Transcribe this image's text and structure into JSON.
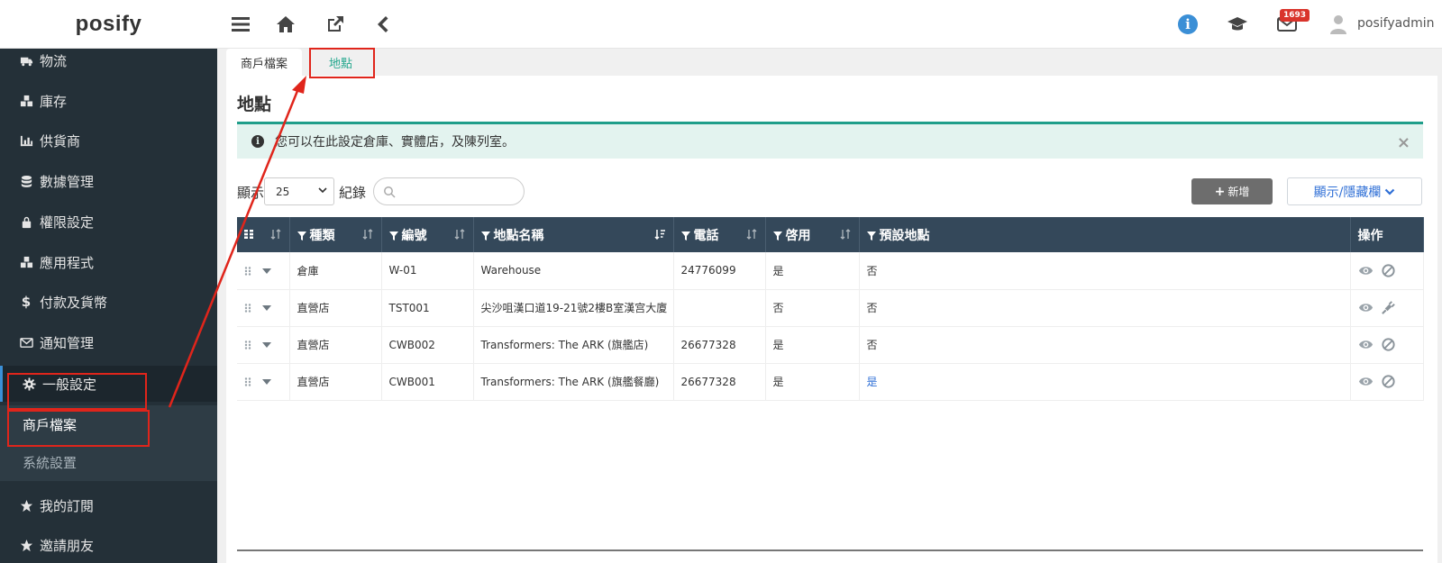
{
  "app": {
    "logo": "posify"
  },
  "topbar": {
    "mail_badge": "1693",
    "user": "posifyadmin"
  },
  "sidebar": {
    "items": [
      {
        "label": "物流",
        "icon": "truck-icon"
      },
      {
        "label": "庫存",
        "icon": "cubes-icon"
      },
      {
        "label": "供貨商",
        "icon": "chart-icon"
      },
      {
        "label": "數據管理",
        "icon": "database-icon"
      },
      {
        "label": "權限設定",
        "icon": "lock-icon"
      },
      {
        "label": "應用程式",
        "icon": "cubes-icon"
      },
      {
        "label": "付款及貨幣",
        "icon": "dollar-icon"
      },
      {
        "label": "通知管理",
        "icon": "envelope-icon"
      },
      {
        "label": "一般設定",
        "icon": "gear-icon"
      }
    ],
    "sub_items": [
      {
        "label": "商戶檔案"
      },
      {
        "label": "系統設置"
      }
    ],
    "bottom_items": [
      {
        "label": "我的訂閱",
        "icon": "star-icon"
      },
      {
        "label": "邀請朋友",
        "icon": "star-icon"
      }
    ]
  },
  "tabs": [
    {
      "label": "商戶檔案"
    },
    {
      "label": "地點"
    }
  ],
  "page": {
    "title": "地點"
  },
  "alert": {
    "message": "您可以在此設定倉庫、實體店，及陳列室。",
    "close": "×"
  },
  "list_controls": {
    "show_label": "顯示",
    "page_size": "25",
    "records_label": "紀錄",
    "search_placeholder": ""
  },
  "buttons": {
    "add": "新增",
    "add_icon": "+",
    "columns": "顯示/隱藏欄"
  },
  "table": {
    "columns": [
      "種類",
      "編號",
      "地點名稱",
      "電話",
      "啓用",
      "預設地點",
      "操作"
    ],
    "rows": [
      {
        "type": "倉庫",
        "code": "W-01",
        "name": "Warehouse",
        "phone": "24776099",
        "enabled": "是",
        "default": "否",
        "action": "disable-icon"
      },
      {
        "type": "直營店",
        "code": "TST001",
        "name": "尖沙咀漢口道19-21號2樓B室漢宫大廈",
        "phone": "",
        "enabled": "否",
        "default": "否",
        "action": "plug-icon"
      },
      {
        "type": "直營店",
        "code": "CWB002",
        "name": "Transformers: The ARK (旗艦店)",
        "phone": "26677328",
        "enabled": "是",
        "default": "否",
        "action": "disable-icon"
      },
      {
        "type": "直營店",
        "code": "CWB001",
        "name": "Transformers: The ARK (旗艦餐廳)",
        "phone": "26677328",
        "enabled": "是",
        "default": "是",
        "action": "disable-icon"
      }
    ]
  },
  "colors": {
    "sidebar_bg": "#243038",
    "header_bg": "#34485a",
    "accent": "#27a88f",
    "link": "#2f6fd6",
    "annotation": "#e0251b"
  }
}
